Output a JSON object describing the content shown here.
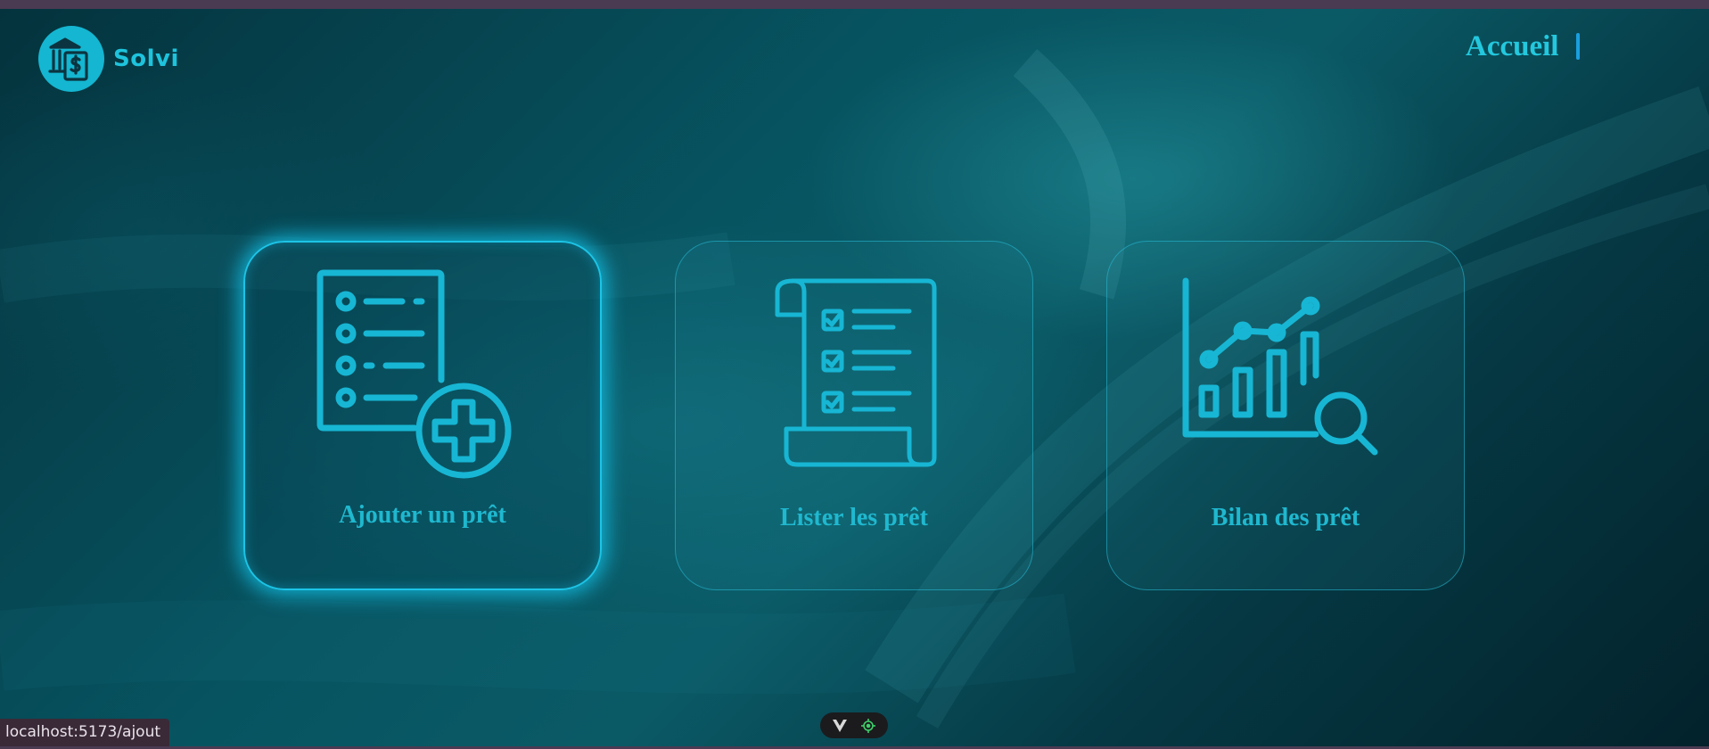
{
  "app": {
    "name": "Solvi",
    "logo_icon": "bank-document-dollar-icon"
  },
  "nav": {
    "home_label": "Accueil"
  },
  "cards": [
    {
      "label": "Ajouter un prêt",
      "icon": "add-list-icon",
      "active": true
    },
    {
      "label": "Lister les prêt",
      "icon": "checklist-scroll-icon",
      "active": false
    },
    {
      "label": "Bilan des prêt",
      "icon": "chart-analysis-icon",
      "active": false
    }
  ],
  "status_bar": {
    "url": "localhost:5173/ajout"
  },
  "dev_toolbar": {
    "icons": [
      "vue-devtools-icon",
      "target-icon"
    ]
  },
  "colors": {
    "accent": "#14b6d1",
    "card_text": "#1fb8cf",
    "nav_text": "#23c8de",
    "glow": "#1cc4e6"
  }
}
